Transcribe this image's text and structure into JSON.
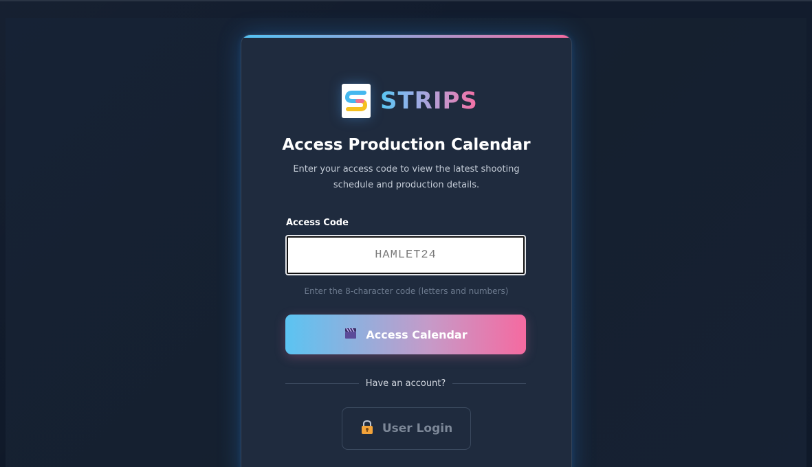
{
  "brand": {
    "name": "STRIPS",
    "logo_letter": "S"
  },
  "heading": {
    "title": "Access Production Calendar",
    "subtitle": "Enter your access code to view the latest shooting schedule and production details."
  },
  "form": {
    "label": "Access Code",
    "value": "HAMLET24",
    "help_text": "Enter the 8-character code (letters and numbers)",
    "submit_label": "Access Calendar",
    "submit_icon": "clapperboard-icon"
  },
  "divider_text": "Have an account?",
  "secondary_button": {
    "label": "User Login",
    "icon": "lock-icon"
  },
  "colors": {
    "accent_blue": "#5bc4f2",
    "accent_pink": "#f56aa0",
    "card_bg": "#1f2b3e",
    "page_bg": "#0f1726"
  }
}
